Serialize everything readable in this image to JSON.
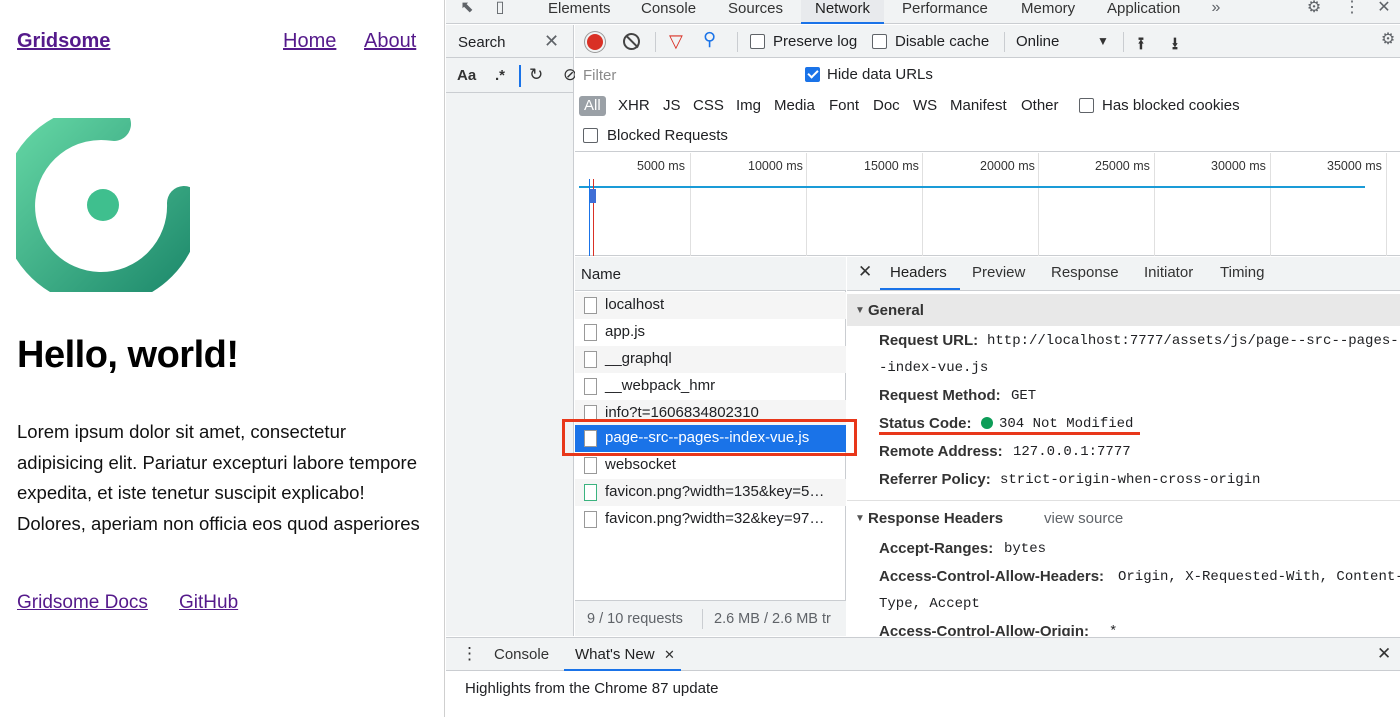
{
  "site": {
    "brand": "Gridsome",
    "nav": {
      "home": "Home",
      "about": "About"
    },
    "heading": "Hello, world!",
    "body": "Lorem ipsum dolor sit amet, consectetur adipisicing elit. Pariatur excepturi labore tempore expedita, et iste tenetur suscipit explicabo! Dolores, aperiam non officia eos quod asperiores",
    "links": {
      "docs": "Gridsome Docs",
      "github": "GitHub"
    },
    "logo_colors": [
      "#5ed3a0",
      "#1f8a6e"
    ]
  },
  "devtools": {
    "tabs": [
      "Elements",
      "Console",
      "Sources",
      "Network",
      "Performance",
      "Memory",
      "Application"
    ],
    "active_tab": "Network",
    "more_tabs_icon": "chevron-double-right-icon",
    "search_panel": {
      "title": "Search",
      "case_option": "Aa",
      "regex_option": ".*"
    },
    "toolbar": {
      "preserve_log": {
        "label": "Preserve log",
        "checked": false
      },
      "disable_cache": {
        "label": "Disable cache",
        "checked": false
      },
      "throttling": "Online"
    },
    "filter": {
      "placeholder": "Filter",
      "hide_data_urls": {
        "label": "Hide data URLs",
        "checked": true
      },
      "types": [
        "All",
        "XHR",
        "JS",
        "CSS",
        "Img",
        "Media",
        "Font",
        "Doc",
        "WS",
        "Manifest",
        "Other"
      ],
      "active_type": "All",
      "has_blocked_cookies": {
        "label": "Has blocked cookies",
        "checked": false
      },
      "blocked_requests": {
        "label": "Blocked Requests",
        "checked": false
      }
    },
    "timeline_ticks": [
      "5000 ms",
      "10000 ms",
      "15000 ms",
      "20000 ms",
      "25000 ms",
      "30000 ms",
      "35000 ms"
    ],
    "requests": {
      "column": "Name",
      "rows": [
        "localhost",
        "app.js",
        "__graphql",
        "__webpack_hmr",
        "info?t=1606834802310",
        "page--src--pages--index-vue.js",
        "websocket",
        "favicon.png?width=135&key=5…",
        "favicon.png?width=32&key=97…"
      ],
      "selected": "page--src--pages--index-vue.js",
      "summary": "9 / 10 requests",
      "transferred": "2.6 MB / 2.6 MB tr"
    },
    "details": {
      "tabs": [
        "Headers",
        "Preview",
        "Response",
        "Initiator",
        "Timing"
      ],
      "active_tab": "Headers",
      "general": {
        "title": "General",
        "request_url_key": "Request URL:",
        "request_url_line1": "http://localhost:7777/assets/js/page--src--pages-",
        "request_url_line2": "-index-vue.js",
        "request_method_key": "Request Method:",
        "request_method": "GET",
        "status_code_key": "Status Code:",
        "status_code": "304 Not Modified",
        "status_color": "#0d9d58",
        "remote_address_key": "Remote Address:",
        "remote_address": "127.0.0.1:7777",
        "referrer_policy_key": "Referrer Policy:",
        "referrer_policy": "strict-origin-when-cross-origin"
      },
      "response_headers": {
        "title": "Response Headers",
        "view_source": "view source",
        "accept_ranges_key": "Accept-Ranges:",
        "accept_ranges": "bytes",
        "acah_key": "Access-Control-Allow-Headers:",
        "acah_line1": "Origin, X-Requested-With, Content-",
        "acah_line2": "Type, Accept",
        "acao_key": "Access-Control-Allow-Origin:",
        "acao": "*"
      }
    },
    "drawer": {
      "tabs": [
        "Console",
        "What's New"
      ],
      "active_tab": "What's New",
      "text": "Highlights from the Chrome 87 update"
    }
  },
  "annotation_color": "#e8371a"
}
